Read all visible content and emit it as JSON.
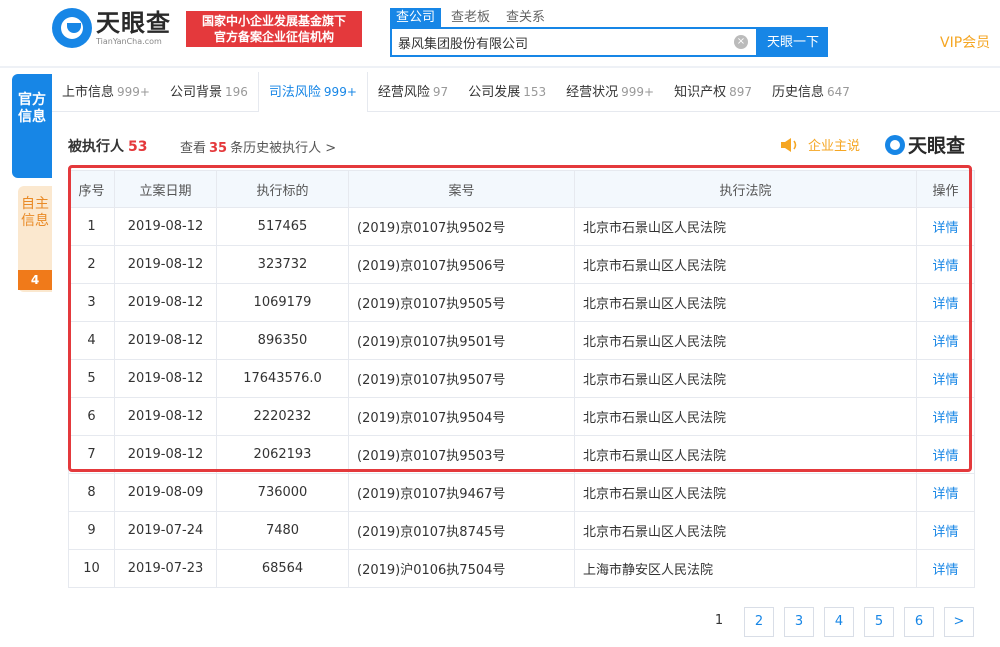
{
  "header": {
    "logo_cn": "天眼查",
    "logo_en": "TianYanCha.com",
    "badge_line1": "国家中小企业发展基金旗下",
    "badge_line2": "官方备案企业征信机构",
    "search_tabs": [
      "查公司",
      "查老板",
      "查关系"
    ],
    "search_value": "暴风集团股份有限公司",
    "search_button": "天眼一下",
    "vip": "VIP会员"
  },
  "side": {
    "official": "官方信息",
    "self": "自主信息",
    "self_count": "4"
  },
  "nav": [
    {
      "label": "上市信息",
      "count": "999+"
    },
    {
      "label": "公司背景",
      "count": "196"
    },
    {
      "label": "司法风险",
      "count": "999+"
    },
    {
      "label": "经营风险",
      "count": "97"
    },
    {
      "label": "公司发展",
      "count": "153"
    },
    {
      "label": "经营状况",
      "count": "999+"
    },
    {
      "label": "知识产权",
      "count": "897"
    },
    {
      "label": "历史信息",
      "count": "647"
    }
  ],
  "section": {
    "title": "被执行人",
    "count": "53",
    "history_prefix": "查看",
    "history_count": "35",
    "history_suffix": "条历史被执行人 >",
    "company_say": "企业主说",
    "brand": "天眼查"
  },
  "table": {
    "headers": [
      "序号",
      "立案日期",
      "执行标的",
      "案号",
      "执行法院",
      "操作"
    ],
    "rows": [
      {
        "no": "1",
        "date": "2019-08-12",
        "amount": "517465",
        "case": "(2019)京0107执9502号",
        "court": "北京市石景山区人民法院",
        "action": "详情"
      },
      {
        "no": "2",
        "date": "2019-08-12",
        "amount": "323732",
        "case": "(2019)京0107执9506号",
        "court": "北京市石景山区人民法院",
        "action": "详情"
      },
      {
        "no": "3",
        "date": "2019-08-12",
        "amount": "1069179",
        "case": "(2019)京0107执9505号",
        "court": "北京市石景山区人民法院",
        "action": "详情"
      },
      {
        "no": "4",
        "date": "2019-08-12",
        "amount": "896350",
        "case": "(2019)京0107执9501号",
        "court": "北京市石景山区人民法院",
        "action": "详情"
      },
      {
        "no": "5",
        "date": "2019-08-12",
        "amount": "17643576.0",
        "case": "(2019)京0107执9507号",
        "court": "北京市石景山区人民法院",
        "action": "详情"
      },
      {
        "no": "6",
        "date": "2019-08-12",
        "amount": "2220232",
        "case": "(2019)京0107执9504号",
        "court": "北京市石景山区人民法院",
        "action": "详情"
      },
      {
        "no": "7",
        "date": "2019-08-12",
        "amount": "2062193",
        "case": "(2019)京0107执9503号",
        "court": "北京市石景山区人民法院",
        "action": "详情"
      },
      {
        "no": "8",
        "date": "2019-08-09",
        "amount": "736000",
        "case": "(2019)京0107执9467号",
        "court": "北京市石景山区人民法院",
        "action": "详情"
      },
      {
        "no": "9",
        "date": "2019-07-24",
        "amount": "7480",
        "case": "(2019)京0107执8745号",
        "court": "北京市石景山区人民法院",
        "action": "详情"
      },
      {
        "no": "10",
        "date": "2019-07-23",
        "amount": "68564",
        "case": "(2019)沪0106执7504号",
        "court": "上海市静安区人民法院",
        "action": "详情"
      }
    ]
  },
  "pagination": [
    "1",
    "2",
    "3",
    "4",
    "5",
    "6",
    ">"
  ],
  "colors": {
    "accent": "#1786e6",
    "alert": "#e4393c",
    "orange": "#f5a623"
  }
}
